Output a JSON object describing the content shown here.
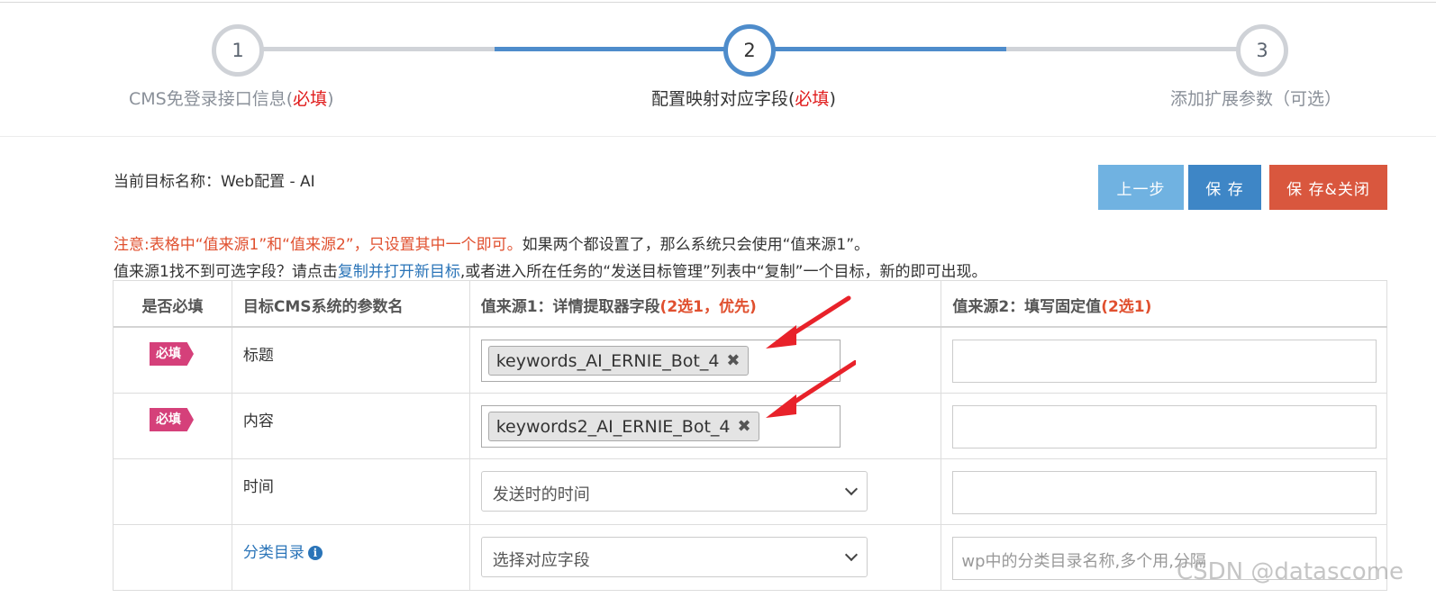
{
  "stepper": {
    "steps": [
      {
        "number": "1",
        "label": "CMS免登录接口信息(",
        "required": "必填",
        "suffix": ")"
      },
      {
        "number": "2",
        "label": "配置映射对应字段(",
        "required": "必填",
        "suffix": ")"
      },
      {
        "number": "3",
        "label": "添加扩展参数（可选）"
      }
    ]
  },
  "header": {
    "target_name": "当前目标名称：Web配置 - AI"
  },
  "toolbar": {
    "prev_label": "上一步",
    "save_label": "保 存",
    "save_close_label": "保 存&关闭"
  },
  "notice": {
    "warning": "注意:表格中“值来源1”和“值来源2”，只设置其中一个即可。",
    "rest": "如果两个都设置了，那么系统只会使用“值来源1”。"
  },
  "help": {
    "prefix": "值来源1找不到可选字段？请点击",
    "link": "复制并打开新目标",
    "suffix": ",或者进入所在任务的“发送目标管理”列表中“复制”一个目标，新的即可出现。"
  },
  "table": {
    "headers": {
      "required": "是否必填",
      "param": "目标CMS系统的参数名",
      "source1": "值来源1：详情提取器字段",
      "source1_note": "(2选1，优先)",
      "source2": "值来源2：填写固定值",
      "source2_note": "(2选1)"
    },
    "rows": [
      {
        "badge": "必填",
        "name": "标题",
        "tag": "keywords_AI_ERNIE_Bot_4",
        "fixed_value": ""
      },
      {
        "badge": "必填",
        "name": "内容",
        "tag": "keywords2_AI_ERNIE_Bot_4",
        "fixed_value": ""
      },
      {
        "name": "时间",
        "select": "发送时的时间",
        "fixed_value": ""
      },
      {
        "name": "分类目录",
        "select": "选择对应字段",
        "placeholder": "wp中的分类目录名称,多个用,分隔"
      }
    ]
  },
  "icons": {
    "remove": "✖",
    "info": "i"
  },
  "colors": {
    "accent": "#4e8ccb",
    "danger": "#d9573e",
    "badge": "#d5407a",
    "arrow": "#e8222a"
  },
  "watermark": "CSDN @datascome"
}
